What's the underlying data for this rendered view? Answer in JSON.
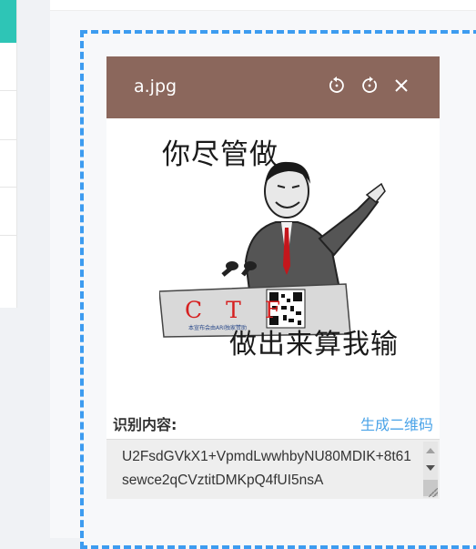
{
  "viewer": {
    "file_name": "a.jpg",
    "icons": {
      "rotate_left": "rotate-left-icon",
      "rotate_right": "rotate-right-icon",
      "close": "close-icon"
    }
  },
  "image": {
    "top_text": "你尽管做",
    "bottom_text": "做出来算我输",
    "podium_text": "C T F",
    "podium_caption": "本宣布会由ARI独家赞助"
  },
  "result": {
    "label": "识别内容:",
    "qr_link": "生成二维码",
    "text": "U2FsdGVkX1+VpmdLwwhbyNU80MDIK+8t61sewce2qCVztitDMKpQ4fUI5nsA"
  },
  "colors": {
    "header_bg": "#8b675c",
    "link": "#4aa3e8",
    "dropzone_border": "#3d9cf0",
    "sidebar_accent": "#2ec5b6"
  }
}
